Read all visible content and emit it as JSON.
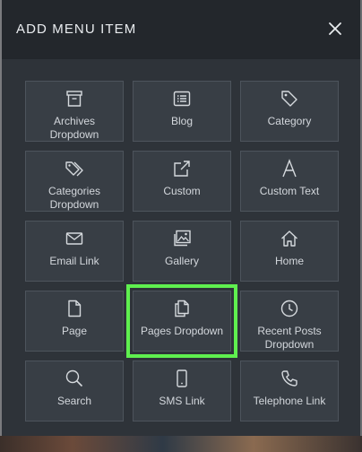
{
  "modal": {
    "title": "ADD MENU ITEM",
    "close_icon": "close-icon"
  },
  "items": [
    {
      "label": "Archives Dropdown",
      "icon": "archive-box-icon"
    },
    {
      "label": "Blog",
      "icon": "list-icon"
    },
    {
      "label": "Category",
      "icon": "tag-icon"
    },
    {
      "label": "Categories Dropdown",
      "icon": "tags-icon"
    },
    {
      "label": "Custom",
      "icon": "external-link-icon"
    },
    {
      "label": "Custom Text",
      "icon": "letter-a-icon"
    },
    {
      "label": "Email Link",
      "icon": "envelope-icon"
    },
    {
      "label": "Gallery",
      "icon": "images-icon"
    },
    {
      "label": "Home",
      "icon": "home-icon"
    },
    {
      "label": "Page",
      "icon": "page-icon"
    },
    {
      "label": "Pages Dropdown",
      "icon": "copy-pages-icon",
      "selected": true
    },
    {
      "label": "Recent Posts Dropdown",
      "icon": "clock-icon"
    },
    {
      "label": "Search",
      "icon": "search-icon"
    },
    {
      "label": "SMS Link",
      "icon": "mobile-phone-icon"
    },
    {
      "label": "Telephone Link",
      "icon": "phone-icon"
    }
  ],
  "colors": {
    "highlight": "#5ff04f",
    "modal_bg": "#2e3339",
    "header_bg": "#23272c",
    "tile_bg": "#383e45"
  }
}
